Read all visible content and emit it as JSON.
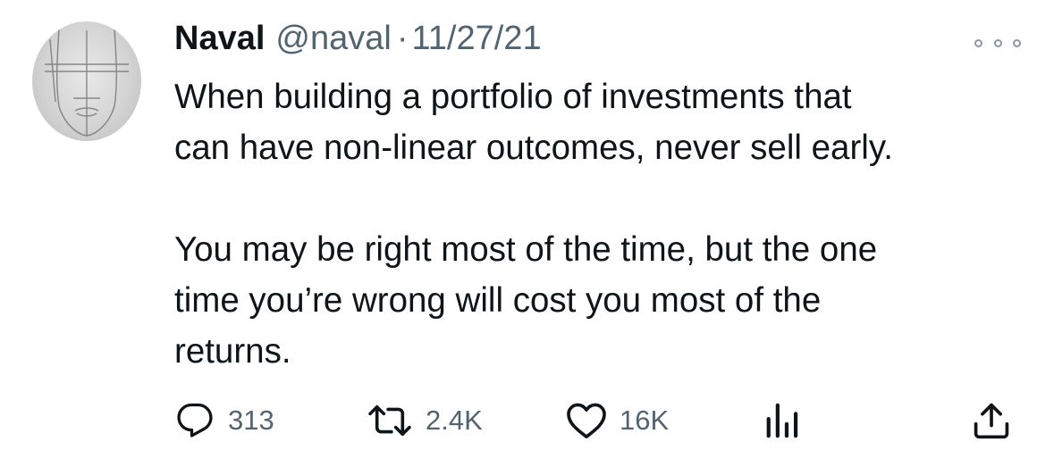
{
  "tweet": {
    "author_name": "Naval",
    "handle": "@naval",
    "separator": "·",
    "date": "11/27/21",
    "body_lines": [
      "When building a portfolio of investments that",
      "can have non-linear outcomes, never sell early.",
      "You may be right most of the time, but the one",
      "time you’re wrong will cost you most of the",
      "returns."
    ]
  },
  "actions": {
    "reply_count": "313",
    "retweet_count": "2.4K",
    "like_count": "16K"
  },
  "icons": {
    "reply": "speech-bubble-icon",
    "retweet": "retweet-arrows-icon",
    "like": "heart-icon",
    "views": "bar-chart-icon",
    "share": "share-upload-icon",
    "more": "ellipsis-icon"
  },
  "colors": {
    "text_primary": "#0f1419",
    "text_secondary": "#536471"
  }
}
